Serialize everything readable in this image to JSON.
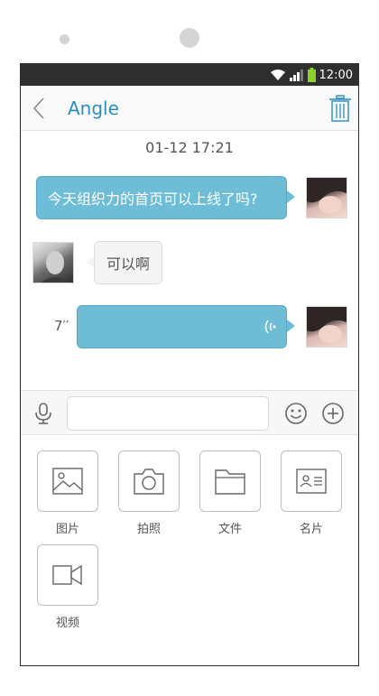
{
  "statusbar": {
    "time": "12:00"
  },
  "header": {
    "title": "Angle"
  },
  "chat": {
    "timestamp": "01-12 17:21",
    "messages": [
      {
        "side": "out",
        "text": "今天组织力的首页可以上线了吗?"
      },
      {
        "side": "in",
        "text": "可以啊"
      },
      {
        "side": "out",
        "type": "voice",
        "duration": "7′′"
      }
    ]
  },
  "input": {
    "placeholder": ""
  },
  "tools": [
    {
      "label": "图片",
      "icon": "image-icon"
    },
    {
      "label": "拍照",
      "icon": "camera-icon"
    },
    {
      "label": "文件",
      "icon": "folder-icon"
    },
    {
      "label": "名片",
      "icon": "contact-card-icon"
    },
    {
      "label": "视频",
      "icon": "video-icon"
    }
  ],
  "colors": {
    "accent": "#2a8fc2",
    "bubble_out": "#6dbdd6",
    "statusbar": "#2f2f2f"
  }
}
